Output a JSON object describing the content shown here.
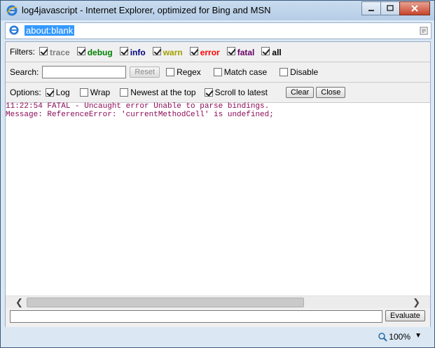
{
  "window": {
    "title": "log4javascript - Internet Explorer, optimized for Bing and MSN",
    "address": "about:blank"
  },
  "filters": {
    "label": "Filters:",
    "items": [
      {
        "label": "trace",
        "checked": true,
        "color": "#808080"
      },
      {
        "label": "debug",
        "checked": true,
        "color": "#008000"
      },
      {
        "label": "info",
        "checked": true,
        "color": "#000080"
      },
      {
        "label": "warn",
        "checked": true,
        "color": "#a0a000"
      },
      {
        "label": "error",
        "checked": true,
        "color": "#ff0000"
      },
      {
        "label": "fatal",
        "checked": true,
        "color": "#660066"
      },
      {
        "label": "all",
        "checked": true,
        "color": "#000000"
      }
    ]
  },
  "search": {
    "label": "Search:",
    "value": "",
    "reset_label": "Reset",
    "regex_label": "Regex",
    "match_case_label": "Match case",
    "disable_label": "Disable"
  },
  "options": {
    "label": "Options:",
    "log_label": "Log",
    "wrap_label": "Wrap",
    "newest_label": "Newest at the top",
    "scroll_label": "Scroll to latest",
    "clear_label": "Clear",
    "close_label": "Close"
  },
  "log": {
    "lines": [
      "11:22:54 FATAL - Uncaught error Unable to parse bindings.",
      "Message: ReferenceError: 'currentMethodCell' is undefined;"
    ]
  },
  "command": {
    "value": "",
    "evaluate_label": "Evaluate"
  },
  "status": {
    "zoom": "100%"
  }
}
